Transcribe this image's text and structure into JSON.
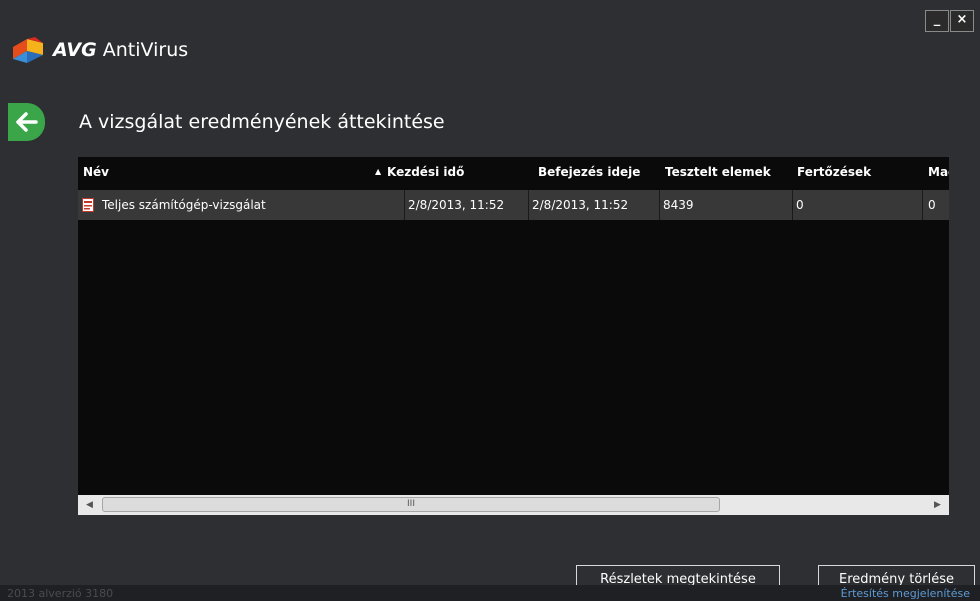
{
  "window": {
    "minimize_label": "_",
    "close_label": "×"
  },
  "app": {
    "brand": "AVG",
    "product": "AntiVirus"
  },
  "page": {
    "title": "A vizsgálat eredményének áttekintése"
  },
  "table": {
    "columns": [
      "Név",
      "Kezdési idő",
      "Befejezés ideje",
      "Tesztelt elemek",
      "Fertőzések",
      "Magas"
    ],
    "sorted_column": "Név",
    "rows": [
      {
        "name": "Teljes számítógép-vizsgálat",
        "start": "2/8/2013, 11:52",
        "end": "2/8/2013, 11:52",
        "tested": "8439",
        "infections": "0",
        "high": "0"
      }
    ],
    "scrollbar_grip": "III"
  },
  "buttons": {
    "details": "Részletek megtekintése",
    "delete": "Eredmény törlése"
  },
  "footer": {
    "version": "2013 alverzió 3180",
    "notification_link": "Értesítés megjelenítése"
  },
  "colors": {
    "back_button": "#3aa649",
    "background": "#2e2f32",
    "link": "#5d9bd6"
  }
}
